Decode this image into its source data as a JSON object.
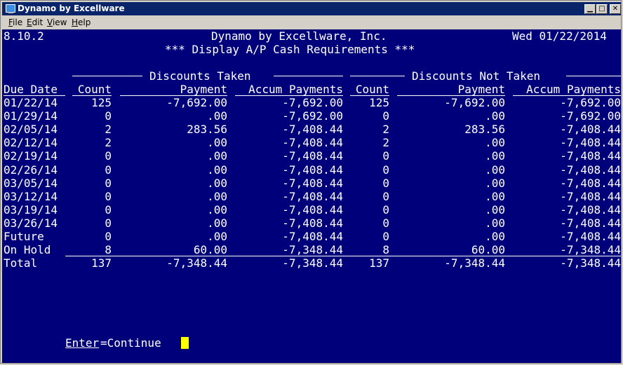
{
  "window": {
    "title": "Dynamo by Excellware"
  },
  "menu": {
    "file": "File",
    "edit": "Edit",
    "view": "View",
    "help": "Help"
  },
  "screen": {
    "version": "8.10.2",
    "company": "Dynamo by Excellware, Inc.",
    "date": "Wed 01/22/2014",
    "subtitle": "*** Display A/P Cash Requirements ***",
    "group_taken": "Discounts Taken",
    "group_not_taken": "Discounts Not Taken",
    "columns": {
      "due_date": "Due Date",
      "count": "Count",
      "payment": "Payment",
      "accum": "Accum Payments",
      "count2": "Count",
      "payment2": "Payment",
      "accum2": "Accum Payments"
    },
    "rows": [
      {
        "date": "01/22/14",
        "c1": "125",
        "p1": "-7,692.00",
        "a1": "-7,692.00",
        "c2": "125",
        "p2": "-7,692.00",
        "a2": "-7,692.00"
      },
      {
        "date": "01/29/14",
        "c1": "0",
        "p1": ".00",
        "a1": "-7,692.00",
        "c2": "0",
        "p2": ".00",
        "a2": "-7,692.00"
      },
      {
        "date": "02/05/14",
        "c1": "2",
        "p1": "283.56",
        "a1": "-7,408.44",
        "c2": "2",
        "p2": "283.56",
        "a2": "-7,408.44"
      },
      {
        "date": "02/12/14",
        "c1": "2",
        "p1": ".00",
        "a1": "-7,408.44",
        "c2": "2",
        "p2": ".00",
        "a2": "-7,408.44"
      },
      {
        "date": "02/19/14",
        "c1": "0",
        "p1": ".00",
        "a1": "-7,408.44",
        "c2": "0",
        "p2": ".00",
        "a2": "-7,408.44"
      },
      {
        "date": "02/26/14",
        "c1": "0",
        "p1": ".00",
        "a1": "-7,408.44",
        "c2": "0",
        "p2": ".00",
        "a2": "-7,408.44"
      },
      {
        "date": "03/05/14",
        "c1": "0",
        "p1": ".00",
        "a1": "-7,408.44",
        "c2": "0",
        "p2": ".00",
        "a2": "-7,408.44"
      },
      {
        "date": "03/12/14",
        "c1": "0",
        "p1": ".00",
        "a1": "-7,408.44",
        "c2": "0",
        "p2": ".00",
        "a2": "-7,408.44"
      },
      {
        "date": "03/19/14",
        "c1": "0",
        "p1": ".00",
        "a1": "-7,408.44",
        "c2": "0",
        "p2": ".00",
        "a2": "-7,408.44"
      },
      {
        "date": "03/26/14",
        "c1": "0",
        "p1": ".00",
        "a1": "-7,408.44",
        "c2": "0",
        "p2": ".00",
        "a2": "-7,408.44"
      },
      {
        "date": "Future",
        "c1": "0",
        "p1": ".00",
        "a1": "-7,408.44",
        "c2": "0",
        "p2": ".00",
        "a2": "-7,408.44"
      },
      {
        "date": "On Hold",
        "c1": "8",
        "p1": "60.00",
        "a1": "-7,348.44",
        "c2": "8",
        "p2": "60.00",
        "a2": "-7,348.44"
      }
    ],
    "total": {
      "date": "Total",
      "c1": "137",
      "p1": "-7,348.44",
      "a1": "-7,348.44",
      "c2": "137",
      "p2": "-7,348.44",
      "a2": "-7,348.44"
    },
    "prompt_key": "Enter",
    "prompt_rest": "=Continue"
  },
  "colors": {
    "console_bg": "#00007b",
    "title_bg": "#0a246a",
    "cursor": "#ffff00"
  }
}
